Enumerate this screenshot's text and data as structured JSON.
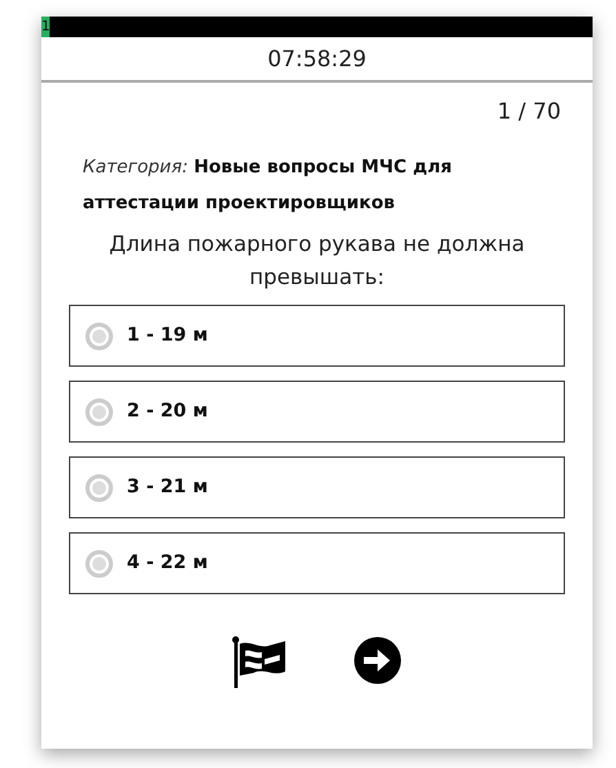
{
  "progress": {
    "label": "1",
    "level": 0.014
  },
  "timer": "07:58:29",
  "counter": "1 / 70",
  "category": {
    "label": "Категория:",
    "value": "Новые вопросы МЧС для аттестации проектировщиков"
  },
  "question": "Длина пожарного рукава не должна превышать:",
  "options": [
    {
      "label": "1 - 19 м",
      "selected": false
    },
    {
      "label": "2 - 20 м",
      "selected": false
    },
    {
      "label": "3 - 21 м",
      "selected": false
    },
    {
      "label": "4 - 22 м",
      "selected": false
    }
  ]
}
